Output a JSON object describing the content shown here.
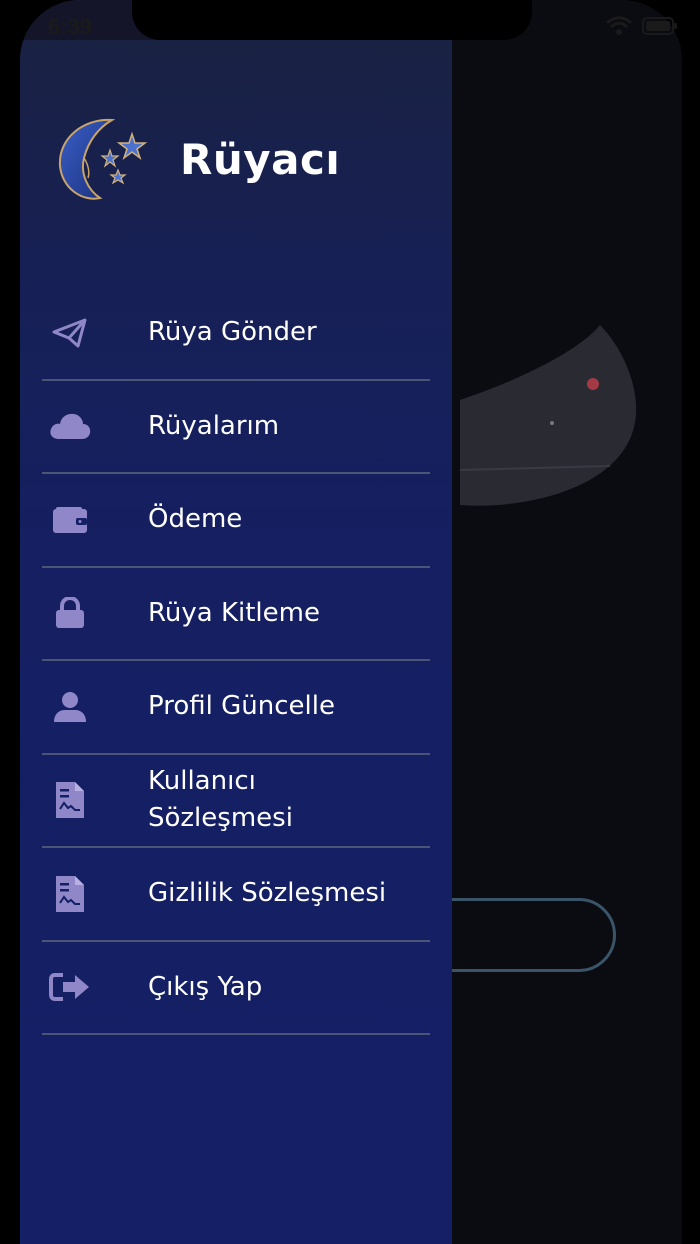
{
  "status_bar": {
    "time": "6:39"
  },
  "app": {
    "title": "Rüyacı"
  },
  "menu": {
    "items": [
      {
        "label": "Rüya Gönder",
        "icon": "send-icon"
      },
      {
        "label": "Rüyalarım",
        "icon": "cloud-icon"
      },
      {
        "label": "Ödeme",
        "icon": "wallet-icon"
      },
      {
        "label": "Rüya Kitleme",
        "icon": "lock-icon"
      },
      {
        "label": "Profil Güncelle",
        "icon": "user-icon"
      },
      {
        "label": "Kullanıcı Sözleşmesi",
        "icon": "document-icon"
      },
      {
        "label": "Gizlilik Sözleşmesi",
        "icon": "document-icon"
      },
      {
        "label": "Çıkış Yap",
        "icon": "sign-out-icon"
      }
    ]
  },
  "colors": {
    "drawer_bg": "#141f66",
    "icon": "#8f87c8",
    "divider": "#4d5577",
    "text": "#ffffff"
  }
}
